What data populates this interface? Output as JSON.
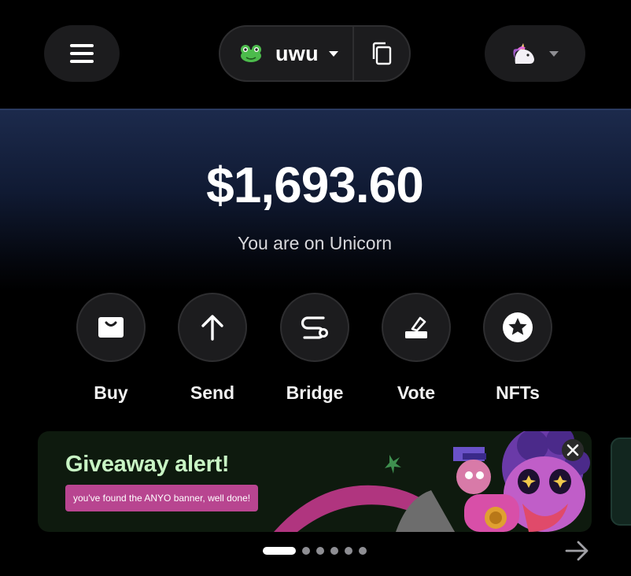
{
  "header": {
    "menu_icon": "hamburger-icon",
    "wallet": {
      "avatar_icon": "frog-icon",
      "name": "uwu",
      "caret_icon": "caret-down-icon",
      "copy_icon": "copy-icon"
    },
    "network": {
      "icon": "unicorn-icon",
      "caret_icon": "caret-down-icon"
    }
  },
  "hero": {
    "balance": "$1,693.60",
    "network_text": "You are on Unicorn"
  },
  "actions": [
    {
      "label": "Buy",
      "icon": "shopping-bag-icon"
    },
    {
      "label": "Send",
      "icon": "arrow-up-icon"
    },
    {
      "label": "Bridge",
      "icon": "bridge-icon"
    },
    {
      "label": "Vote",
      "icon": "ballot-box-icon"
    },
    {
      "label": "NFTs",
      "icon": "star-badge-icon"
    }
  ],
  "banner": {
    "title": "Giveaway alert!",
    "subtitle": "you've found the ANYO banner, well done!",
    "close_icon": "close-icon",
    "art_icon": "cartoon-character-art"
  },
  "carousel": {
    "count": 6,
    "active_index": 0,
    "next_icon": "arrow-right-icon"
  },
  "colors": {
    "background": "#000000",
    "surface": "#1c1c1e",
    "hero_top": "#1c2a4c",
    "banner_title": "#c8f5c4",
    "banner_badge": "#b84590"
  }
}
